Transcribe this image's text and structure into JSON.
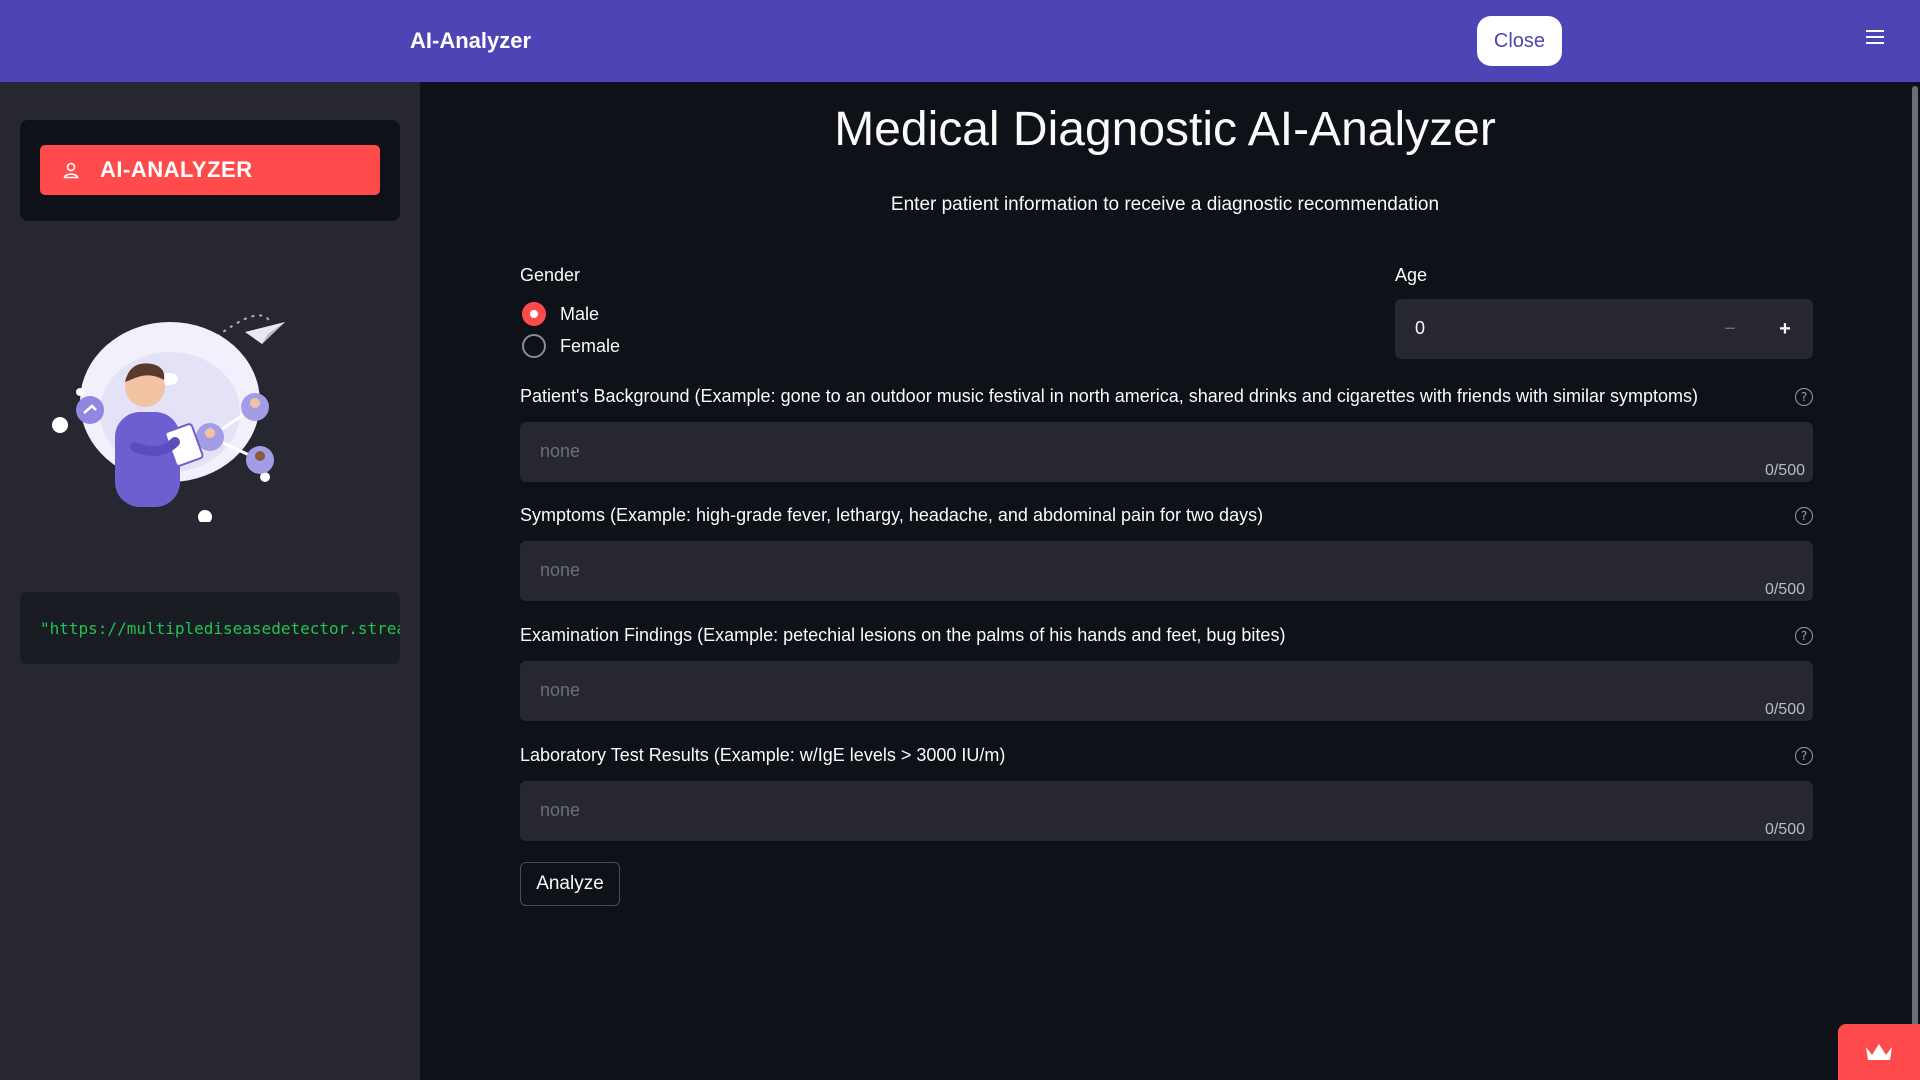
{
  "header": {
    "app_title": "AI-Analyzer",
    "close_label": "Close",
    "background_color": "#4d44b5"
  },
  "sidebar": {
    "nav_item_label": "AI-ANALYZER",
    "nav_item_icon": "person-icon",
    "code_text": "\"https://multiplediseasedetector.streamlit.app\""
  },
  "main": {
    "title": "Medical Diagnostic AI-Analyzer",
    "subtitle": "Enter patient information to receive a diagnostic recommendation",
    "gender": {
      "label": "Gender",
      "options": [
        "Male",
        "Female"
      ],
      "selected": "Male"
    },
    "age": {
      "label": "Age",
      "value": "0",
      "minus_label": "−",
      "plus_label": "+"
    },
    "fields": [
      {
        "label": "Patient's Background (Example: gone to an outdoor music festival in north america, shared drinks and cigarettes with friends with similar symptoms)",
        "placeholder": "none",
        "counter": "0/500"
      },
      {
        "label": "Symptoms (Example: high-grade fever, lethargy, headache, and abdominal pain for two days)",
        "placeholder": "none",
        "counter": "0/500"
      },
      {
        "label": "Examination Findings (Example: petechial lesions on the palms of his hands and feet, bug bites)",
        "placeholder": "none",
        "counter": "0/500"
      },
      {
        "label": "Laboratory Test Results (Example: w/IgE levels > 3000 IU/m)",
        "placeholder": "none",
        "counter": "0/500"
      }
    ],
    "help_icon_glyph": "?",
    "analyze_label": "Analyze"
  },
  "accent_color": "#ff4b4b"
}
